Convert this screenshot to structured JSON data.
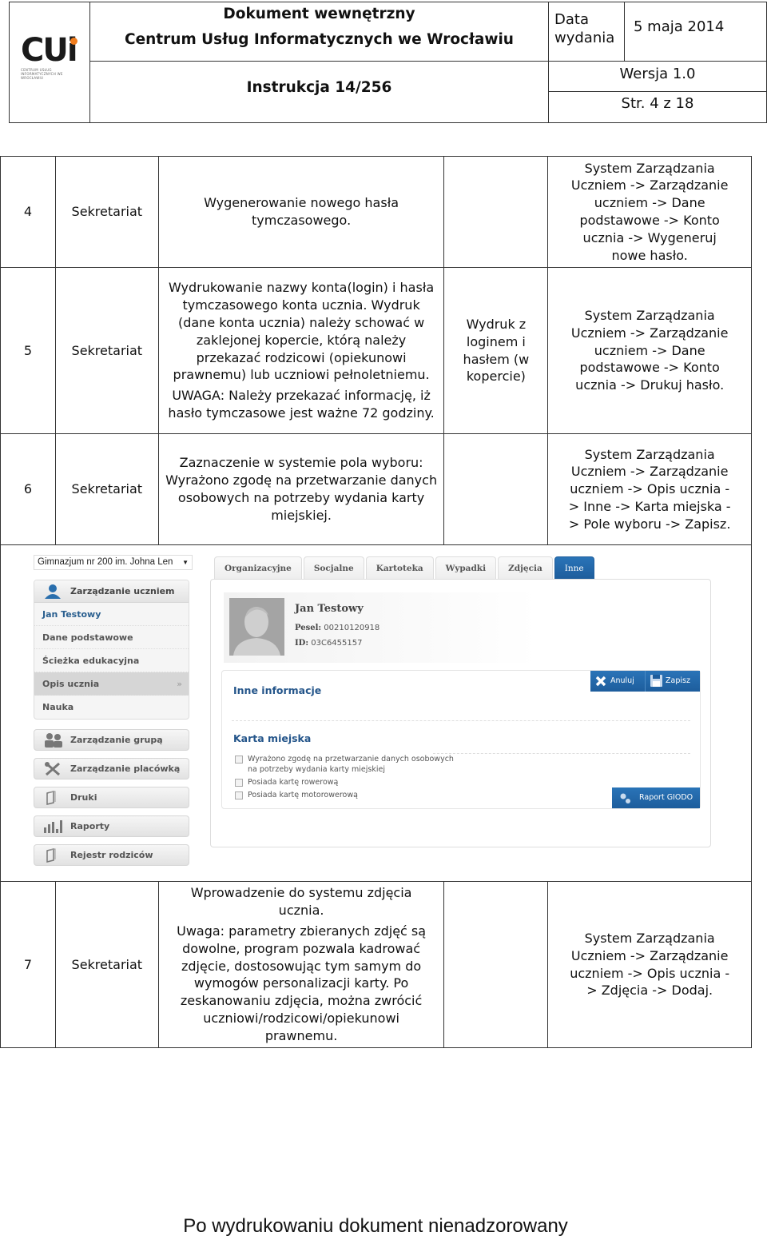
{
  "header": {
    "logo_text": "CUi",
    "logo_subtext": "CENTRUM USŁUG INFORMATYCZNYCH WE WROCŁAWIU",
    "doc_type": "Dokument wewnętrzny",
    "organization": "Centrum Usług Informatycznych we Wrocławiu",
    "instruction": "Instrukcja 14/256",
    "date_label": "Data wydania",
    "date_value": "5 maja 2014",
    "version": "Wersja 1.0",
    "page": "Str. 4 z 18"
  },
  "table": {
    "rows": [
      {
        "num": "4",
        "who": "Sekretariat",
        "desc": [
          "Wygenerowanie nowego hasła tymczasowego."
        ],
        "output": "",
        "path": "System Zarządzania Uczniem -> Zarządzanie uczniem -> Dane podstawowe -> Konto ucznia -> Wygeneruj nowe hasło."
      },
      {
        "num": "5",
        "who": "Sekretariat",
        "desc": [
          "Wydrukowanie nazwy konta(login) i hasła tymczasowego konta ucznia. Wydruk (dane konta ucznia) należy schować w zaklejonej kopercie, którą należy przekazać  rodzicowi (opiekunowi prawnemu) lub uczniowi pełnoletniemu.",
          "UWAGA: Należy przekazać informację, iż hasło tymczasowe jest ważne 72 godziny."
        ],
        "output": "Wydruk z loginem i hasłem (w kopercie)",
        "path": "System Zarządzania Uczniem -> Zarządzanie uczniem -> Dane podstawowe -> Konto ucznia -> Drukuj hasło."
      },
      {
        "num": "6",
        "who": "Sekretariat",
        "desc": [
          "Zaznaczenie w systemie pola wyboru: Wyrażono zgodę na przetwarzanie danych osobowych na potrzeby wydania karty miejskiej."
        ],
        "output": "",
        "path": "System Zarządzania Uczniem -> Zarządzanie uczniem -> Opis ucznia -> Inne -> Karta miejska -> Pole wyboru -> Zapisz."
      },
      {
        "num": "7",
        "who": "Sekretariat",
        "desc": [
          "Wprowadzenie do systemu zdjęcia ucznia.",
          "Uwaga: parametry zbieranych zdjęć są dowolne, program pozwala kadrować zdjęcie, dostosowując tym samym do wymogów personalizacji karty. Po zeskanowaniu zdjęcia, można zwrócić uczniowi/rodzicowi/opiekunowi prawnemu."
        ],
        "output": "",
        "path": "System Zarządzania Uczniem -> Zarządzanie uczniem -> Opis ucznia -> Zdjęcia -> Dodaj."
      }
    ]
  },
  "screenshot": {
    "school_select": "Gimnazjum nr 200 im. Johna Len",
    "sidebar": {
      "section_title": "Zarządzanie uczniem",
      "items": [
        "Jan Testowy",
        "Dane podstawowe",
        "Ścieżka edukacyjna",
        "Opis ucznia",
        "Nauka"
      ],
      "selected_chevron": "»",
      "buttons": [
        "Zarządzanie grupą",
        "Zarządzanie placówką",
        "Druki",
        "Raporty",
        "Rejestr rodziców"
      ]
    },
    "tabs": [
      "Organizacyjne",
      "Socjalne",
      "Kartoteka",
      "Wypadki",
      "Zdjęcia",
      "Inne"
    ],
    "active_tab": "Inne",
    "profile": {
      "name": "Jan Testowy",
      "pesel_label": "Pesel:",
      "pesel": "00210120918",
      "id_label": "ID:",
      "id": "03C6455157"
    },
    "section_other": "Inne informacje",
    "section_card": "Karta miejska",
    "cancel_label": "Anuluj",
    "save_label": "Zapisz",
    "checkboxes": [
      {
        "label": "Wyrażono zgodę na przetwarzanie danych osobowych na potrzeby wydania karty miejskiej",
        "checked": false
      },
      {
        "label": "Posiada kartę rowerową",
        "checked": false
      },
      {
        "label": "Posiada kartę motorowerową",
        "checked": false
      }
    ],
    "report_label": "Raport GIODO",
    "colors": {
      "accent": "#1d5d9c",
      "heading": "#24558a",
      "logo_dot": "#f07d1e"
    }
  },
  "footer": "Po wydrukowaniu dokument nienadzorowany"
}
